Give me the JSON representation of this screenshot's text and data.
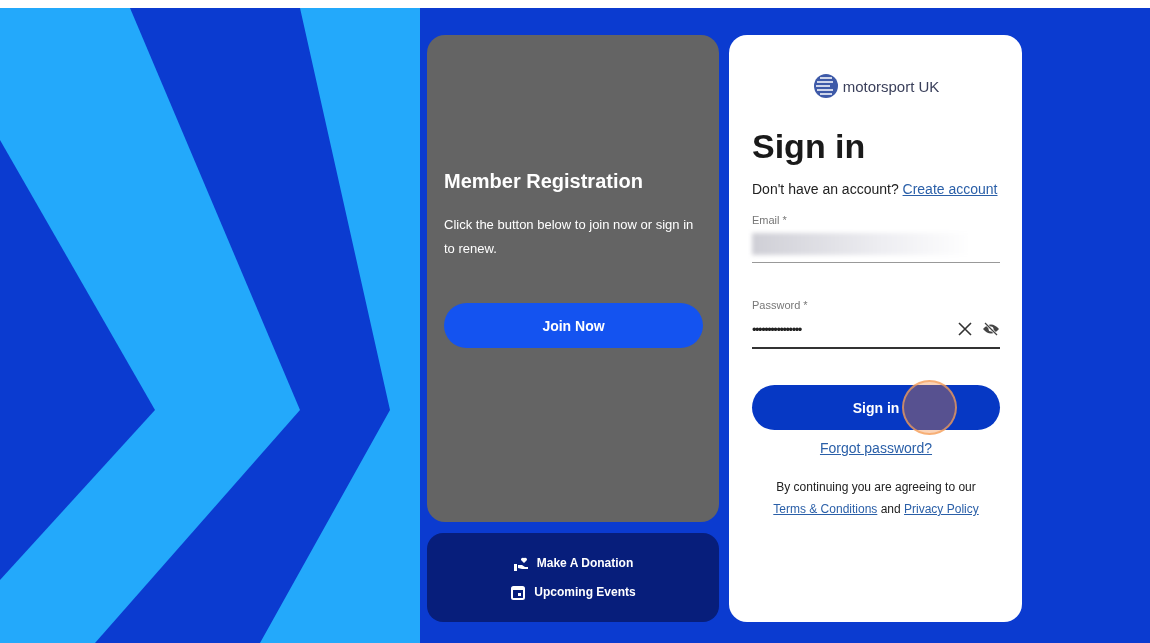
{
  "promo": {
    "title": "Member Registration",
    "text": "Click the button below to join now or sign in to renew.",
    "button": "Join Now"
  },
  "quick_links": [
    {
      "kind": "donation",
      "label": "Make A Donation"
    },
    {
      "kind": "events",
      "label": "Upcoming Events"
    }
  ],
  "signin": {
    "logo_text": "motorsport UK",
    "title": "Sign in",
    "prompt": "Don't have an account?",
    "create_link": "Create account",
    "fields": [
      {
        "kind": "email",
        "label": "Email *",
        "focused": false
      },
      {
        "kind": "password",
        "label": "Password *",
        "value": "••••••••••••••••",
        "focused": true
      }
    ],
    "button": "Sign in",
    "forgot_link": "Forgot password?",
    "legal": {
      "before": "By continuing you are agreeing to our",
      "terms": "Terms & Conditions",
      "between": "and",
      "privacy": "Privacy Policy"
    }
  }
}
